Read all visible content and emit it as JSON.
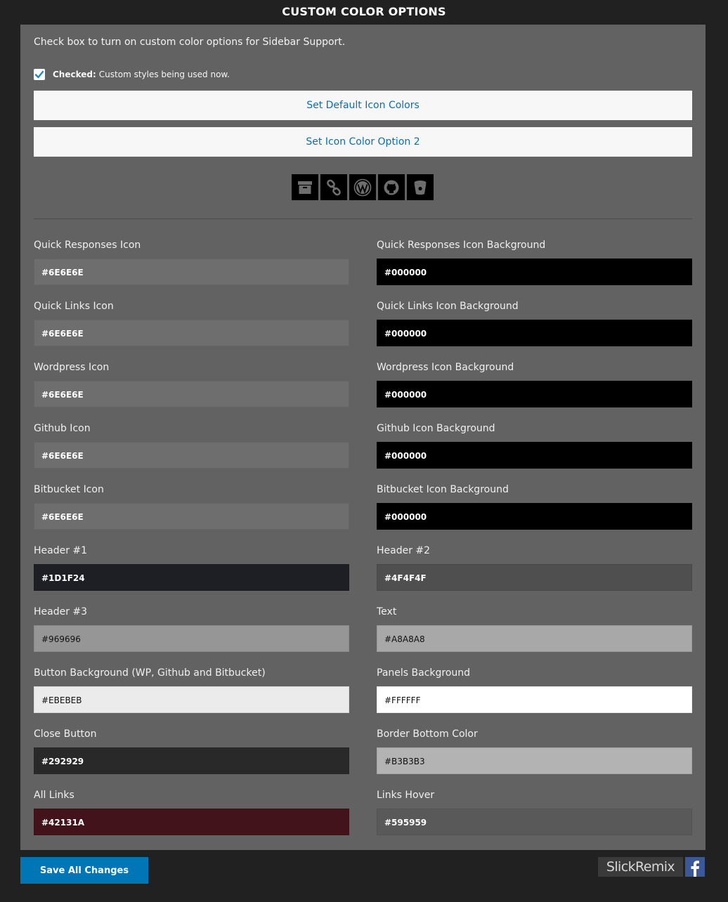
{
  "header": {
    "title": "CUSTOM COLOR OPTIONS"
  },
  "intro": {
    "text": "Check box to turn on custom color options for Sidebar Support."
  },
  "checkbox": {
    "bold": "Checked:",
    "text": "Custom styles being used now.",
    "checked": true
  },
  "buttons": {
    "default_colors": "Set Default Icon Colors",
    "option2": "Set Icon Color Option 2",
    "save": "Save All Changes"
  },
  "preview_icons": [
    "archive-icon",
    "link-icon",
    "wordpress-icon",
    "github-icon",
    "bitbucket-icon"
  ],
  "fields": [
    {
      "label": "Quick Responses Icon",
      "value": "#6E6E6E"
    },
    {
      "label": "Quick Responses Icon Background",
      "value": "#000000"
    },
    {
      "label": "Quick Links Icon",
      "value": "#6E6E6E"
    },
    {
      "label": "Quick Links Icon Background",
      "value": "#000000"
    },
    {
      "label": "Wordpress Icon",
      "value": "#6E6E6E"
    },
    {
      "label": "Wordpress Icon Background",
      "value": "#000000"
    },
    {
      "label": "Github Icon",
      "value": "#6E6E6E"
    },
    {
      "label": "Github Icon Background",
      "value": "#000000"
    },
    {
      "label": "Bitbucket Icon",
      "value": "#6E6E6E"
    },
    {
      "label": "Bitbucket Icon Background",
      "value": "#000000"
    },
    {
      "label": "Header #1",
      "value": "#1D1F24"
    },
    {
      "label": "Header #2",
      "value": "#4F4F4F"
    },
    {
      "label": "Header #3",
      "value": "#969696"
    },
    {
      "label": "Text",
      "value": "#A8A8A8"
    },
    {
      "label": "Button Background (WP, Github and Bitbucket)",
      "value": "#EBEBEB"
    },
    {
      "label": "Panels Background",
      "value": "#FFFFFF"
    },
    {
      "label": "Close Button",
      "value": "#292929"
    },
    {
      "label": "Border Bottom Color",
      "value": "#B3B3B3"
    },
    {
      "label": "All Links",
      "value": "#42131A"
    },
    {
      "label": "Links Hover",
      "value": "#595959"
    }
  ],
  "brand": {
    "name": "SlickRemix",
    "social": "facebook-icon"
  },
  "colors": {
    "page_bg": "#212121",
    "panel_bg": "#626262",
    "link_blue": "#0D6EA9",
    "save_bg": "#0076B6"
  }
}
